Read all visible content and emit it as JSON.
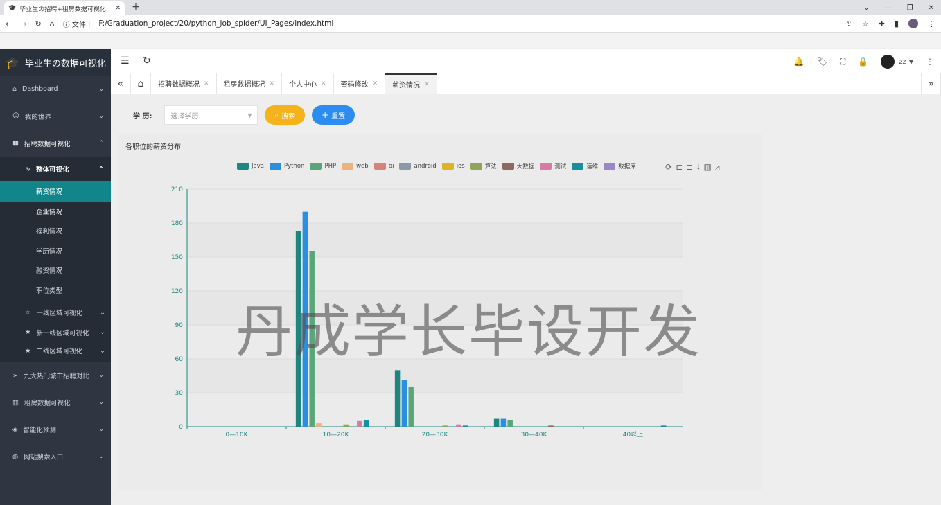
{
  "browser": {
    "tab_title": "毕业生の招聘+租房数据可视化",
    "url_prefix": "文件",
    "url": "F:/Graduation_project/20/python_job_spider/UI_Pages/index.html"
  },
  "sidebar": {
    "logo_text": "毕业生の数据可视化",
    "items": [
      {
        "label": "Dashboard"
      },
      {
        "label": "我的世界"
      },
      {
        "label": "招聘数据可视化"
      },
      {
        "label": "九大热门城市招聘对比"
      },
      {
        "label": "租房数据可视化"
      },
      {
        "label": "智能化预测"
      },
      {
        "label": "网站搜索入口"
      }
    ],
    "group": {
      "label": "整体可视化"
    },
    "sub_items": [
      "薪资情况",
      "企业情况",
      "福利情况",
      "学历情况",
      "融资情况",
      "职位类型"
    ],
    "region_items": [
      "一线区域可视化",
      "新一线区域可视化",
      "二线区域可视化"
    ]
  },
  "header": {
    "user": "zz"
  },
  "page_tabs": [
    {
      "label": "招聘数据概况"
    },
    {
      "label": "租房数据概况"
    },
    {
      "label": "个人中心"
    },
    {
      "label": "密码修改"
    },
    {
      "label": "薪资情况"
    }
  ],
  "filter": {
    "label": "学 历:",
    "placeholder": "选择学历",
    "search_label": "搜索",
    "reset_label": "重置"
  },
  "card": {
    "title": "各职位的薪资分布"
  },
  "watermark": "丹成学长毕设开发",
  "colors": {
    "sidebar_bg": "#2f3642",
    "active_item": "#11858a",
    "search_btn": "#f4b21b",
    "reset_btn": "#2d8cf0"
  },
  "chart_data": {
    "type": "bar",
    "title": "",
    "categories": [
      "0—10K",
      "10—20K",
      "20—30K",
      "30—40K",
      "40以上"
    ],
    "ylim": [
      0,
      210
    ],
    "yticks": [
      0,
      30,
      60,
      90,
      120,
      150,
      180,
      210
    ],
    "legend_position": "top",
    "series": [
      {
        "name": "Java",
        "color": "#1e857f",
        "values": [
          0,
          173,
          50,
          7,
          0
        ]
      },
      {
        "name": "Python",
        "color": "#2b8fe0",
        "values": [
          0,
          190,
          41,
          7,
          0
        ]
      },
      {
        "name": "PHP",
        "color": "#5aa679",
        "values": [
          0,
          155,
          35,
          6,
          0
        ]
      },
      {
        "name": "web",
        "color": "#eeb27c",
        "values": [
          0,
          3,
          0,
          0,
          0
        ]
      },
      {
        "name": "bi",
        "color": "#d6837a",
        "values": [
          0,
          0,
          0,
          0,
          0
        ]
      },
      {
        "name": "android",
        "color": "#8b9aa8",
        "values": [
          0,
          0,
          0,
          0,
          0
        ]
      },
      {
        "name": "ios",
        "color": "#dfb22a",
        "values": [
          0,
          0,
          0,
          0,
          0
        ]
      },
      {
        "name": "算法",
        "color": "#8fa65a",
        "values": [
          0,
          2,
          1,
          0,
          0
        ]
      },
      {
        "name": "大数据",
        "color": "#8c6a60",
        "values": [
          0,
          0,
          0,
          1,
          0
        ]
      },
      {
        "name": "测试",
        "color": "#d97aa6",
        "values": [
          0,
          5,
          2,
          0,
          0
        ]
      },
      {
        "name": "运维",
        "color": "#178f9e",
        "values": [
          0,
          6,
          1,
          0,
          1
        ]
      },
      {
        "name": "数据库",
        "color": "#9b86c8",
        "values": [
          0,
          0,
          0,
          0,
          0
        ]
      }
    ]
  }
}
